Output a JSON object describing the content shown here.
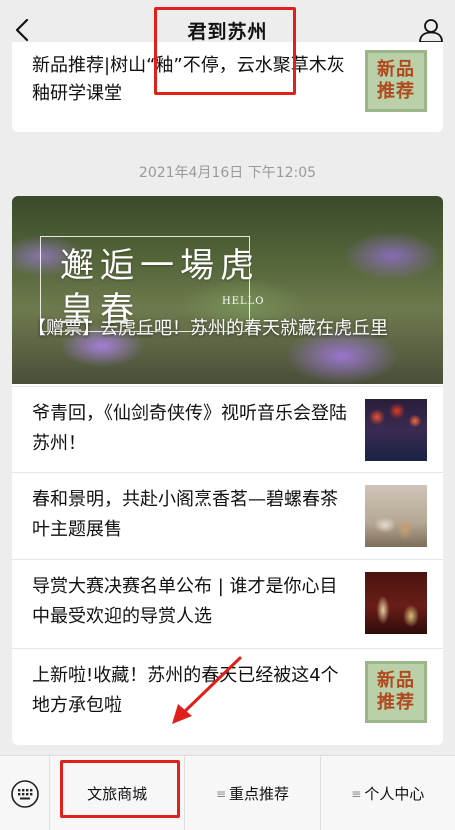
{
  "header": {
    "title": "君到苏州",
    "back_icon": "chevron-left-icon",
    "profile_icon": "person-icon"
  },
  "messages": {
    "previous_card": {
      "item_title": "新品推荐|树山“釉”不停，云水聚草木灰釉研学课堂",
      "thumb_line1": "新品",
      "thumb_line2": "推荐"
    },
    "timestamp": "2021年4月16日 下午12:05",
    "article_card": {
      "hero": {
        "image_text": "邂逅一場虎皇春",
        "image_text_small": "HELLO",
        "caption": "【赠票】去虎丘吧！苏州的春天就藏在虎丘里"
      },
      "items": [
        {
          "title": "爷青回，《仙剑奇侠传》视听音乐会登陆苏州！",
          "thumb": "opera-thumbnail"
        },
        {
          "title": "春和景明，共赴小阁烹香茗—碧螺春茶叶主题展售",
          "thumb": "tea-thumbnail"
        },
        {
          "title": "导赏大赛决赛名单公布 | 谁才是你心目中最受欢迎的导赏人选",
          "thumb": "stage-thumbnail"
        },
        {
          "title": "上新啦!收藏！苏州的春天已经被这4个地方承包啦",
          "thumb": "new-product-thumbnail",
          "thumb_line1": "新品",
          "thumb_line2": "推荐"
        }
      ]
    }
  },
  "bottom_menu": {
    "keyboard_icon": "keyboard-icon",
    "items": [
      {
        "label": "文旅商城",
        "has_submenu": false
      },
      {
        "label": "重点推荐",
        "has_submenu": true
      },
      {
        "label": "个人中心",
        "has_submenu": true
      }
    ]
  },
  "colors": {
    "background": "#ededed",
    "annotation": "#e0201a",
    "thumb_green": "#b9d0a8",
    "thumb_text": "#b1491e"
  }
}
